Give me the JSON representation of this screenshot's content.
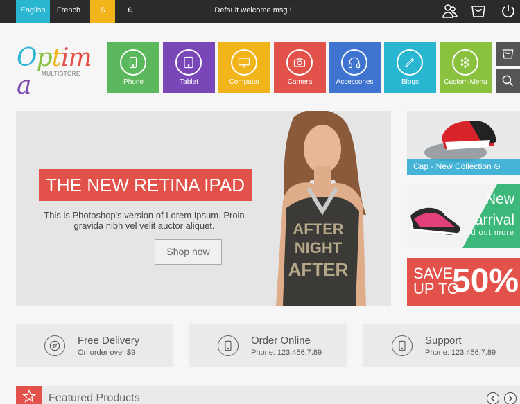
{
  "topbar": {
    "lang_english": "English",
    "lang_french": "French",
    "currency_usd": "$",
    "currency_eur": "€",
    "welcome": "Default welcome msg !",
    "icons": [
      "users-icon",
      "cart-icon",
      "power-icon"
    ]
  },
  "logo": {
    "letters": [
      "O",
      "p",
      "t",
      "i",
      "m",
      "a"
    ],
    "letter_colors": [
      "#2bb3d3",
      "#8ac13f",
      "#f2b41b",
      "#e2524a",
      "#e2524a",
      "#7e4bb0"
    ],
    "sub": "MULTISTORE"
  },
  "categories": [
    {
      "label": "Phone",
      "color": "#5cb85c",
      "icon": "phone-icon"
    },
    {
      "label": "Tablet",
      "color": "#7a47b8",
      "icon": "tablet-icon"
    },
    {
      "label": "Computer",
      "color": "#f2b41b",
      "icon": "monitor-icon"
    },
    {
      "label": "Camera",
      "color": "#e2524a",
      "icon": "camera-icon"
    },
    {
      "label": "Accessories",
      "color": "#3e74cf",
      "icon": "headphones-icon"
    },
    {
      "label": "Blogs",
      "color": "#29b6d0",
      "icon": "pencil-icon"
    },
    {
      "label": "Custom Menu",
      "color": "#8ac13f",
      "icon": "dots-circle-icon"
    }
  ],
  "side_buttons": {
    "cart": "cart-icon",
    "search": "search-icon"
  },
  "banner": {
    "title": "THE NEW RETINA IPAD",
    "desc_line1": "This is Photoshop's version  of Lorem Ipsum. Proin",
    "desc_line2": "gravida nibh vel velit auctor aliquet.",
    "button": "Shop now"
  },
  "promos": {
    "cap_label": "Cap - New Collection ⊙",
    "new_line1": "New",
    "new_line2": "arrival",
    "new_line3": "find out more",
    "save_line1": "SAVE",
    "save_line2": "UP TO",
    "save_pct": "50%"
  },
  "services": [
    {
      "title": "Free Delivery",
      "sub": "On order over $9",
      "icon": "compass-icon"
    },
    {
      "title": "Order Online",
      "sub": "Phone: 123.456.7.89",
      "icon": "phone-icon"
    },
    {
      "title": "Support",
      "sub": "Phone: 123.456.7.89",
      "icon": "phone-icon"
    }
  ],
  "featured": {
    "title": "Featured Products"
  }
}
